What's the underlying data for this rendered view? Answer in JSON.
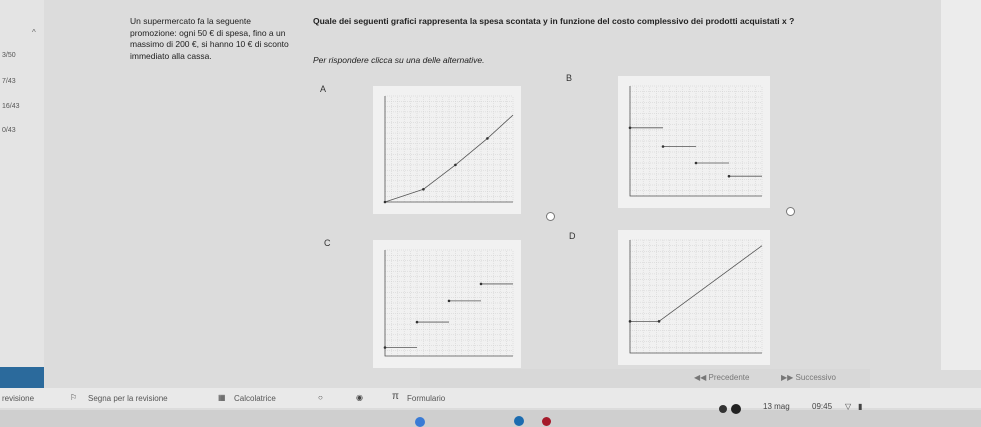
{
  "sidebar": {
    "scores": [
      "3/50",
      "7/43",
      "16/43",
      "0/43"
    ]
  },
  "problem_text": "Un supermercato fa la seguente promozione: ogni 50 € di spesa, fino a un massimo di 200 €, si hanno 10 € di sconto immediato alla cassa.",
  "question": {
    "text": "Quale dei seguenti grafici rappresenta la spesa scontata y in funzione del costo complessivo dei prodotti acquistati x ?",
    "instruction": "Per rispondere clicca su una delle alternative."
  },
  "options": [
    {
      "letter": "A"
    },
    {
      "letter": "B"
    },
    {
      "letter": "C"
    },
    {
      "letter": "D"
    }
  ],
  "chart_data": [
    {
      "type": "line",
      "option": "A",
      "description_hidden": "",
      "y_style": "rising-steps",
      "segments": [
        [
          0,
          0,
          0.3,
          0.12
        ],
        [
          0.3,
          0.12,
          0.55,
          0.35
        ],
        [
          0.55,
          0.35,
          0.8,
          0.6
        ],
        [
          0.8,
          0.6,
          1,
          0.82
        ]
      ]
    },
    {
      "type": "line",
      "option": "B",
      "y_style": "falling-steps",
      "segments": [
        [
          0,
          0.62,
          0.25,
          0.62
        ],
        [
          0.25,
          0.45,
          0.5,
          0.45
        ],
        [
          0.5,
          0.3,
          0.75,
          0.3
        ],
        [
          0.75,
          0.18,
          1,
          0.18
        ]
      ]
    },
    {
      "type": "line",
      "option": "C",
      "y_style": "rising-steps",
      "segments": [
        [
          0,
          0.08,
          0.25,
          0.08
        ],
        [
          0.25,
          0.32,
          0.5,
          0.32
        ],
        [
          0.5,
          0.52,
          0.75,
          0.52
        ],
        [
          0.75,
          0.68,
          1,
          0.68
        ]
      ]
    },
    {
      "type": "line",
      "option": "D",
      "y_style": "plateau-then-linear",
      "segments": [
        [
          0,
          0.28,
          0.22,
          0.28
        ],
        [
          0.22,
          0.28,
          1,
          0.95
        ]
      ]
    }
  ],
  "toolbar": {
    "revisione": "revisione",
    "segna": "Segna per la revisione",
    "calcolatrice": "Calcolatrice",
    "formulario": "Formulario",
    "precedente": "Precedente",
    "successivo": "Successivo"
  },
  "taskbar": {
    "date": "13 mag",
    "time": "09:45"
  }
}
